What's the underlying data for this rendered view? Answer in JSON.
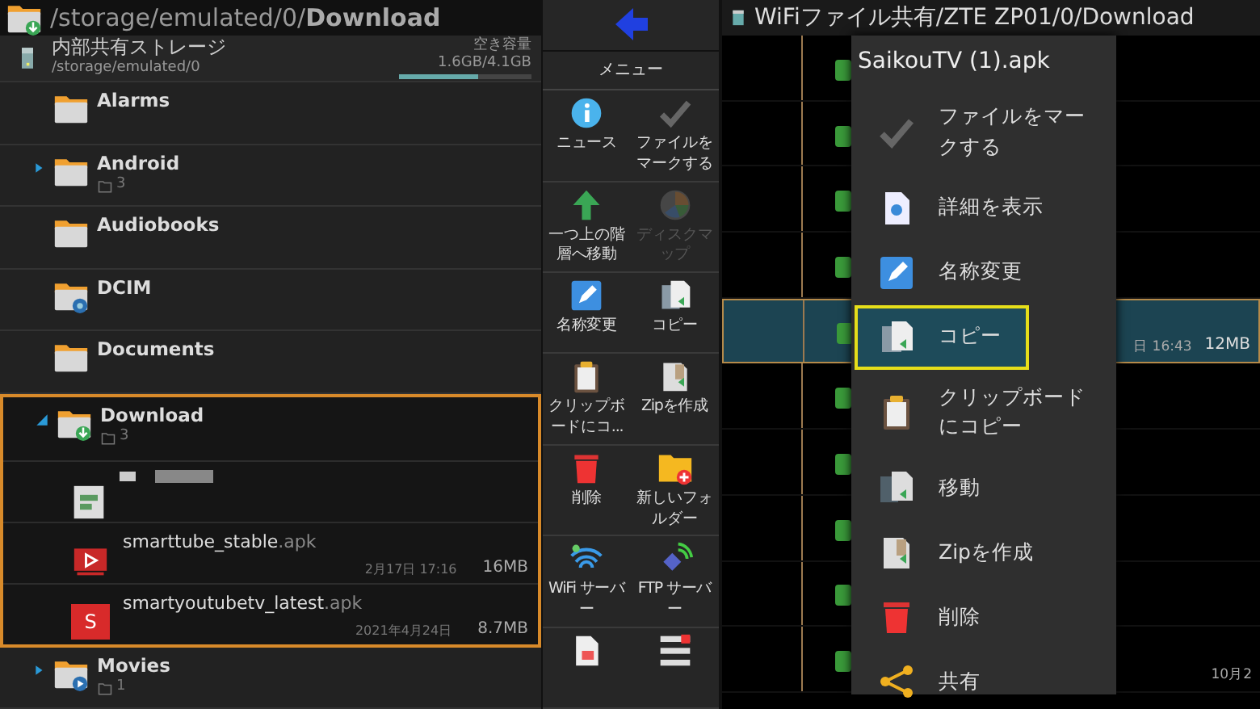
{
  "left_panel": {
    "path": "/storage/emulated/0/**Download**",
    "storage": {
      "name": "内部共有ストレージ",
      "path": "/storage/emulated/0",
      "free_label": "空き容量",
      "free_value": "1.6GB/4.1GB",
      "level": 0.6
    },
    "items": [
      {
        "kind": "folder",
        "name": "Alarms",
        "selected": false
      },
      {
        "kind": "folder",
        "name": "Android",
        "count": "3",
        "expanded": false,
        "selected": false
      },
      {
        "kind": "folder",
        "name": "Audiobooks",
        "selected": false
      },
      {
        "kind": "folder",
        "name": "DCIM",
        "selected": false
      },
      {
        "kind": "folder",
        "name": "Documents",
        "selected": false
      },
      {
        "kind": "folder",
        "name": "Download",
        "count": "3",
        "expanded": true,
        "selected": true,
        "children": [
          {
            "kind": "hidden-file"
          },
          {
            "kind": "file",
            "name": "smarttube_stable",
            "ext": ".apk",
            "date": "2月17日 17:16",
            "size": "16MB"
          },
          {
            "kind": "file",
            "name": "smartyoutubetv_latest",
            "ext": ".apk",
            "date": "2021年4月24日",
            "size": "8.7MB",
            "letter": "S"
          }
        ]
      },
      {
        "kind": "folder",
        "name": "Movies",
        "count": "1",
        "expanded": false,
        "selected": false
      }
    ]
  },
  "menu": {
    "title": "メニュー",
    "items": [
      {
        "label": "ニュース",
        "disabled": false
      },
      {
        "label": "ファイルをマークする",
        "disabled": false
      },
      {
        "label": "一つ上の階層へ移動",
        "disabled": false
      },
      {
        "label": "ディスクマップ",
        "disabled": true
      },
      {
        "label": "名称変更",
        "disabled": false
      },
      {
        "label": "コピー",
        "disabled": false
      },
      {
        "label": "クリップボードにコ...",
        "disabled": false
      },
      {
        "label": "Zipを作成",
        "disabled": false
      },
      {
        "label": "削除",
        "disabled": false
      },
      {
        "label": "新しいフォルダー",
        "disabled": false
      },
      {
        "label": "WiFi サーバー",
        "disabled": false
      },
      {
        "label": "FTP サーバー",
        "disabled": false
      }
    ]
  },
  "right_panel": {
    "title": "WiFiファイル共有/ZTE ZP01/0/Download",
    "rows": [
      {
        "selected": false
      },
      {
        "selected": false
      },
      {
        "selected": false
      },
      {
        "selected": false
      },
      {
        "selected": true,
        "date": "日 16:43",
        "size": "12MB"
      },
      {
        "selected": false
      },
      {
        "selected": false
      },
      {
        "selected": false
      },
      {
        "selected": false
      },
      {
        "selected": false,
        "date": "10月2"
      }
    ],
    "popup": {
      "title": "SaikouTV (1).apk",
      "items": [
        {
          "label": "ファイルをマークする",
          "selected": false
        },
        {
          "label": "詳細を表示",
          "selected": false
        },
        {
          "label": "名称変更",
          "selected": false
        },
        {
          "label": "コピー",
          "selected": true
        },
        {
          "label": "クリップボードにコピー",
          "selected": false
        },
        {
          "label": "移動",
          "selected": false
        },
        {
          "label": "Zipを作成",
          "selected": false
        },
        {
          "label": "削除",
          "selected": false
        },
        {
          "label": "共有",
          "selected": false
        }
      ]
    }
  }
}
